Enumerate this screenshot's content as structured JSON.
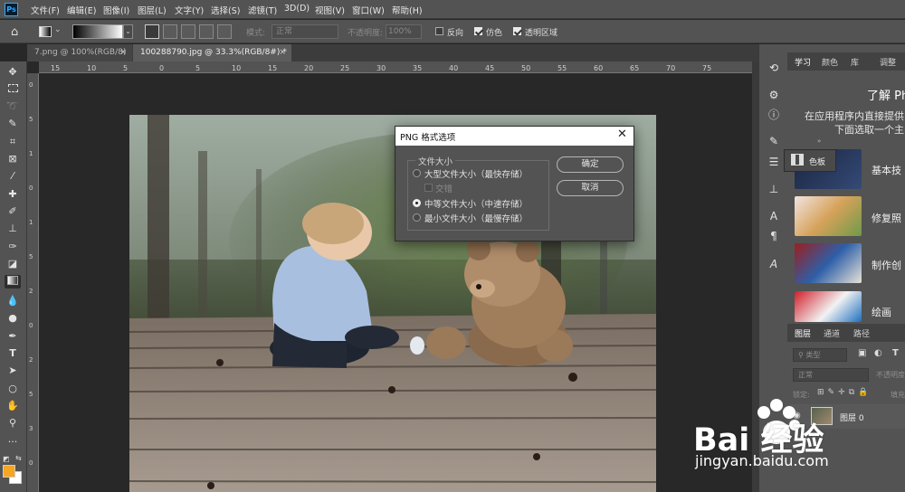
{
  "app": {
    "logo": "Ps"
  },
  "menu": [
    "文件(F)",
    "编辑(E)",
    "图像(I)",
    "图层(L)",
    "文字(Y)",
    "选择(S)",
    "滤镜(T)",
    "3D(D)",
    "视图(V)",
    "窗口(W)",
    "帮助(H)"
  ],
  "options": {
    "mode_label": "模式:",
    "mode_value": "正常",
    "opacity_label": "不透明度:",
    "opacity_value": "100%",
    "reverse_label": "反向",
    "dither_label": "仿色",
    "transparency_label": "透明区域"
  },
  "tabs": [
    {
      "label": "7.png @ 100%(RGB/8)",
      "close": "×"
    },
    {
      "label": "100288790.jpg @ 33.3%(RGB/8#) *",
      "close": "×"
    }
  ],
  "ruler": {
    "h": [
      "15",
      "10",
      "5",
      "0",
      "5",
      "10",
      "15",
      "20",
      "25",
      "30",
      "35",
      "40",
      "45",
      "50",
      "55",
      "60",
      "65",
      "70",
      "75"
    ],
    "v": [
      "0",
      "5",
      "1",
      "0",
      "1",
      "5",
      "2",
      "0",
      "2",
      "5",
      "3",
      "0"
    ]
  },
  "dialog": {
    "title": "PNG 格式选项",
    "close": "✕",
    "group_title": "文件大小",
    "options": [
      {
        "label": "大型文件大小（最快存储）",
        "selected": false,
        "enabled": true
      },
      {
        "label": "交错",
        "selected": false,
        "enabled": false
      },
      {
        "label": "中等文件大小（中速存储）",
        "selected": true,
        "enabled": true
      },
      {
        "label": "最小文件大小（最慢存储）",
        "selected": false,
        "enabled": true
      }
    ],
    "ok_label": "确定",
    "cancel_label": "取消"
  },
  "right_panel": {
    "tabs": [
      "学习",
      "颜色",
      "库",
      "调整"
    ],
    "learn_title": "了解 Ph",
    "learn_desc_1": "在应用程序内直接提供",
    "learn_desc_2": "下面选取一个主",
    "swatch_label": "色板",
    "lessons": [
      "基本技",
      "修复照",
      "制作创",
      "绘画"
    ]
  },
  "layers": {
    "tabs": [
      "图层",
      "通道",
      "路径"
    ],
    "kind_placeholder": "类型",
    "blend_mode": "正常",
    "opacity_label": "不透明度",
    "lock_label": "锁定:",
    "fill_label": "填充",
    "layer_name": "图层 0"
  },
  "watermark": {
    "text": "Bai 经验",
    "url": "jingyan.baidu.com"
  },
  "colors": {
    "foreground": "#f5a623",
    "background": "#ffffff",
    "accent": "#31a8ff"
  }
}
